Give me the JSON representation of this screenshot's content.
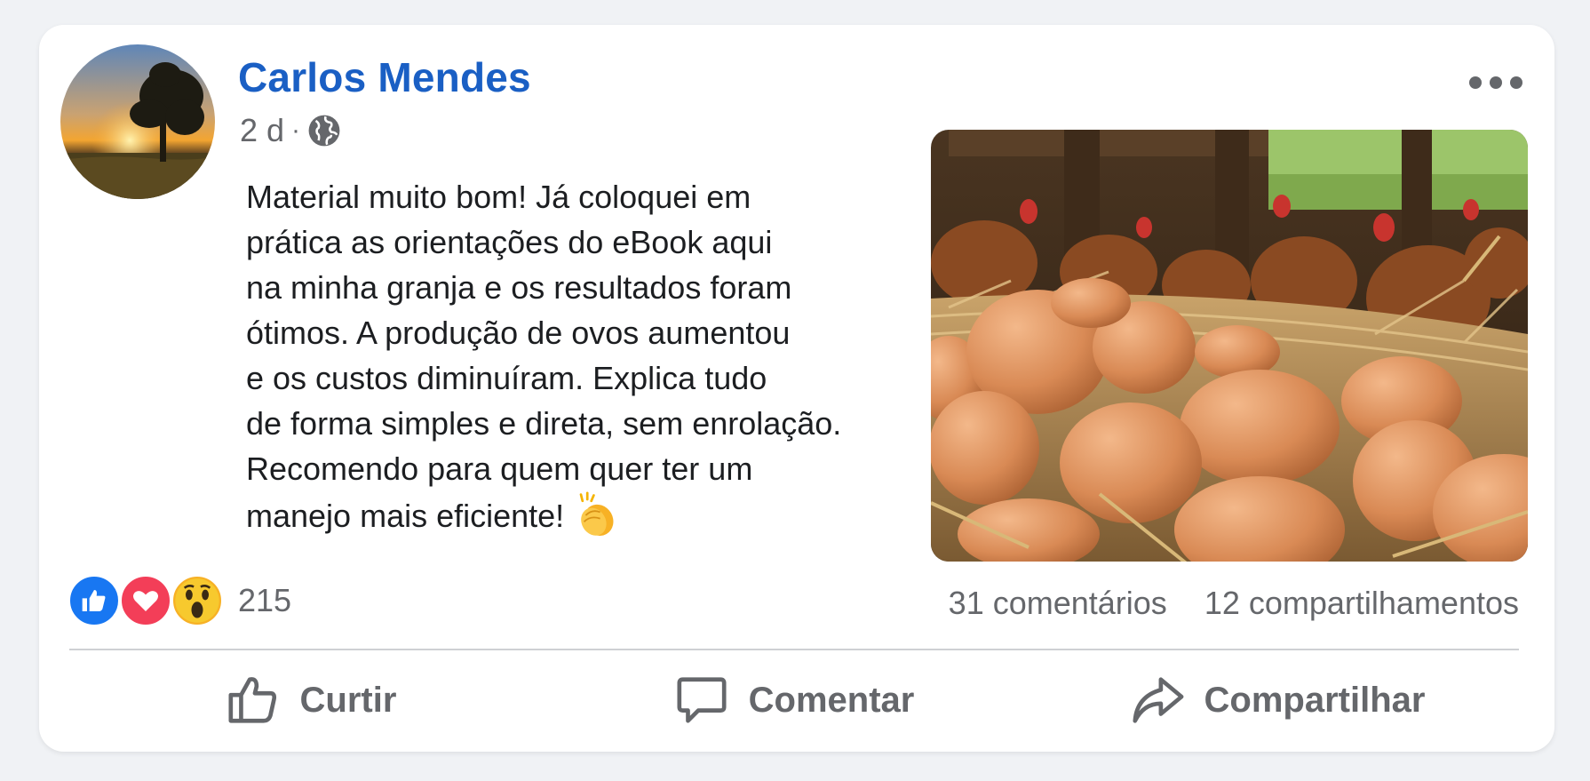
{
  "post": {
    "author": "Carlos Mendes",
    "time": "2 d",
    "separator": "·",
    "text_lines": [
      "Material muito bom! Já coloquei em",
      "prática as orientações do eBook aqui",
      "na minha granja e os resultados foram",
      "ótimos. A produção de ovos aumentou",
      "e os custos diminuíram. Explica tudo",
      "de forma simples e direta, sem enrolação.",
      "Recomendo para quem quer ter um",
      "manejo mais eficiente!"
    ]
  },
  "reactions": {
    "types": [
      "like",
      "love",
      "wow"
    ],
    "count": "215"
  },
  "stats": {
    "comments": "31 comentários",
    "shares": "12 compartilhamentos"
  },
  "actions": {
    "like": "Curtir",
    "comment": "Comentar",
    "share": "Compartilhar"
  },
  "icons": {
    "globe": "globe-icon",
    "more": "more-options-icon",
    "clap": "clapping-hands-emoji",
    "like": "thumbs-up-icon",
    "comment": "speech-bubble-icon",
    "share": "share-arrow-icon"
  },
  "colors": {
    "author": "#1a5fc4",
    "like_reaction": "#1877f2",
    "love_reaction": "#f33e58",
    "wow_reaction": "#f7b125",
    "muted_text": "#65676b"
  }
}
